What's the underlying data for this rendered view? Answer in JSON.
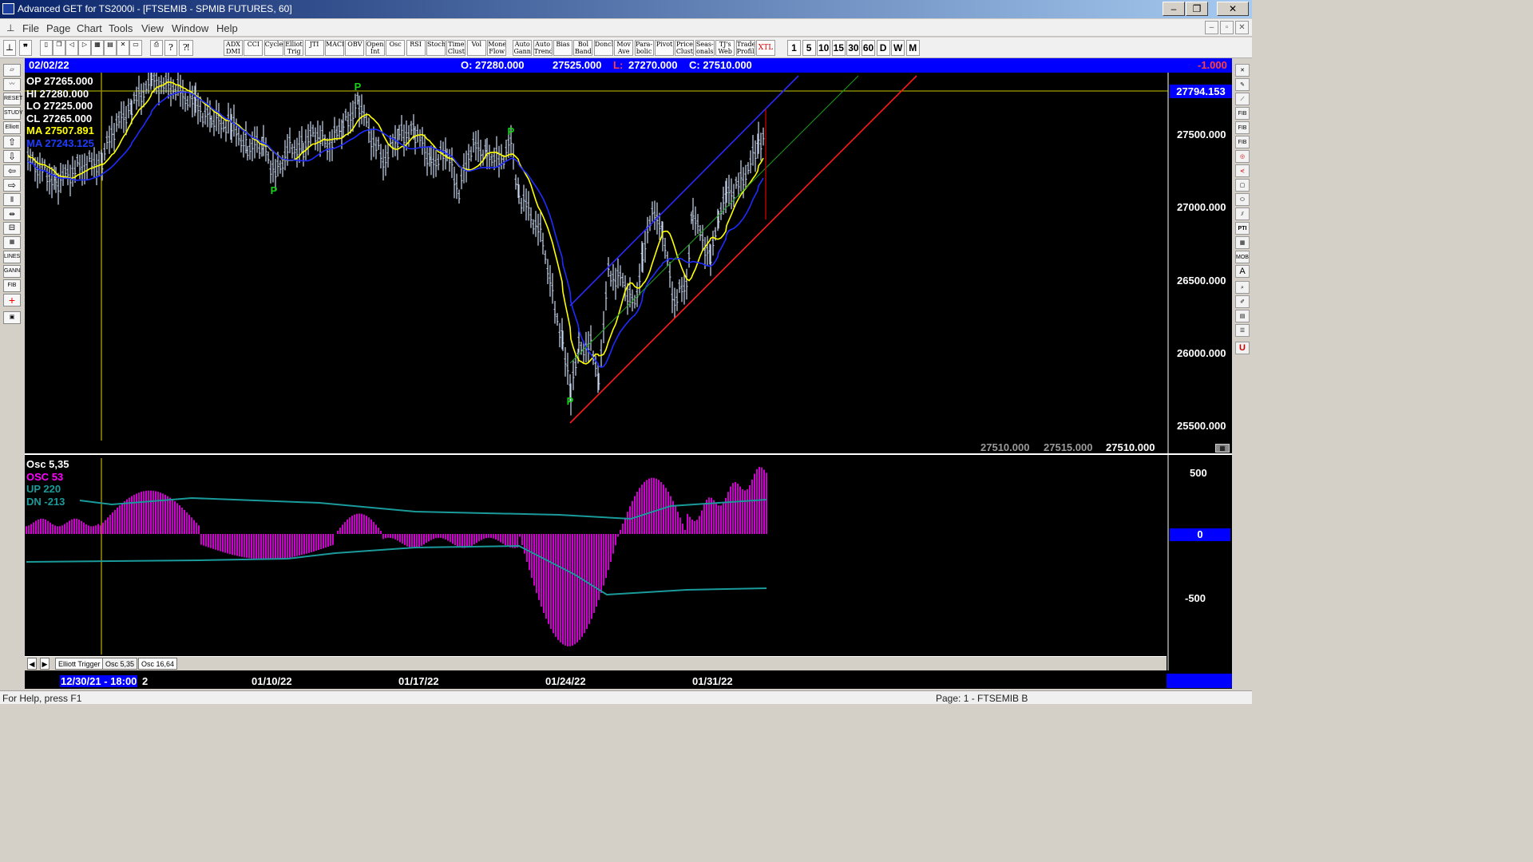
{
  "window": {
    "title": "Advanced GET for TS2000i - [FTSEMIB - SPMIB FUTURES, 60]",
    "controls": [
      "–",
      "❐",
      "✕"
    ]
  },
  "menu": [
    "File",
    "Page",
    "Chart",
    "Tools",
    "View",
    "Window",
    "Help"
  ],
  "toolbar": {
    "study_buttons": [
      "ADX DMI",
      "CCI",
      "Cycles",
      "Elliott Trig",
      "JTI",
      "MACD",
      "OBV",
      "Open Int",
      "Osc",
      "RSI",
      "Stoch",
      "Time Clust",
      "Vol",
      "Money Flow",
      "Auto Gann",
      "Auto Trend",
      "Bias",
      "Bol Band",
      "Donch",
      "Mov Ave",
      "Para-bolic",
      "Pivot",
      "Price Clust",
      "Seas-onals",
      "TJ's Web",
      "Trade Profile",
      "XTL"
    ],
    "intervals": [
      "1",
      "5",
      "10",
      "15",
      "30",
      "60",
      "D",
      "W",
      "M"
    ]
  },
  "infobar": {
    "date": "02/02/22",
    "open": "O: 27280.000",
    "high": "27525.000",
    "low_prefix": "L:",
    "low": "27270.000",
    "close": "C: 27510.000",
    "change": "-1.000"
  },
  "ohlc_panel": {
    "op": "OP  27265.000",
    "hi": "HI   27280.000",
    "lo": "LO  27225.000",
    "cl": "CL  27265.000",
    "ma1": "MA  27507.891",
    "ma2": "MA  27243.125"
  },
  "price_axis": {
    "marker": "27794.153",
    "ticks": [
      "27500.000",
      "27000.000",
      "26500.000",
      "26000.000",
      "25500.000"
    ]
  },
  "bottom_readout": [
    "27510.000",
    "27515.000",
    "27510.000"
  ],
  "oscillator": {
    "title": "Osc 5,35",
    "osc": "OSC 53",
    "up": "UP   220",
    "dn": "DN   -213",
    "ticks": [
      "500",
      "0",
      "-500"
    ]
  },
  "tabs": [
    "Elliott Trigger",
    "Osc 5,35",
    "Osc 16,64"
  ],
  "dates": {
    "cursor": "12/30/21 - 18:00",
    "cursor_suffix": "2",
    "labels": [
      "01/10/22",
      "01/17/22",
      "01/24/22",
      "01/31/22"
    ]
  },
  "pivot_label": "P",
  "status": {
    "help": "For Help, press F1",
    "page": "Page: 1 - FTSEMIB B"
  },
  "colors": {
    "info_bg": "#0000ff",
    "price_bars": "#c8d8f0",
    "ma_fast": "#ffff00",
    "ma_slow": "#1e2cff",
    "channel_red": "#ff1a1a",
    "channel_green": "#1ea01e",
    "channel_blue": "#2a2aff",
    "osc_hist": "#ff00ff",
    "osc_band": "#1a9a9a",
    "pivot": "#18d018"
  }
}
